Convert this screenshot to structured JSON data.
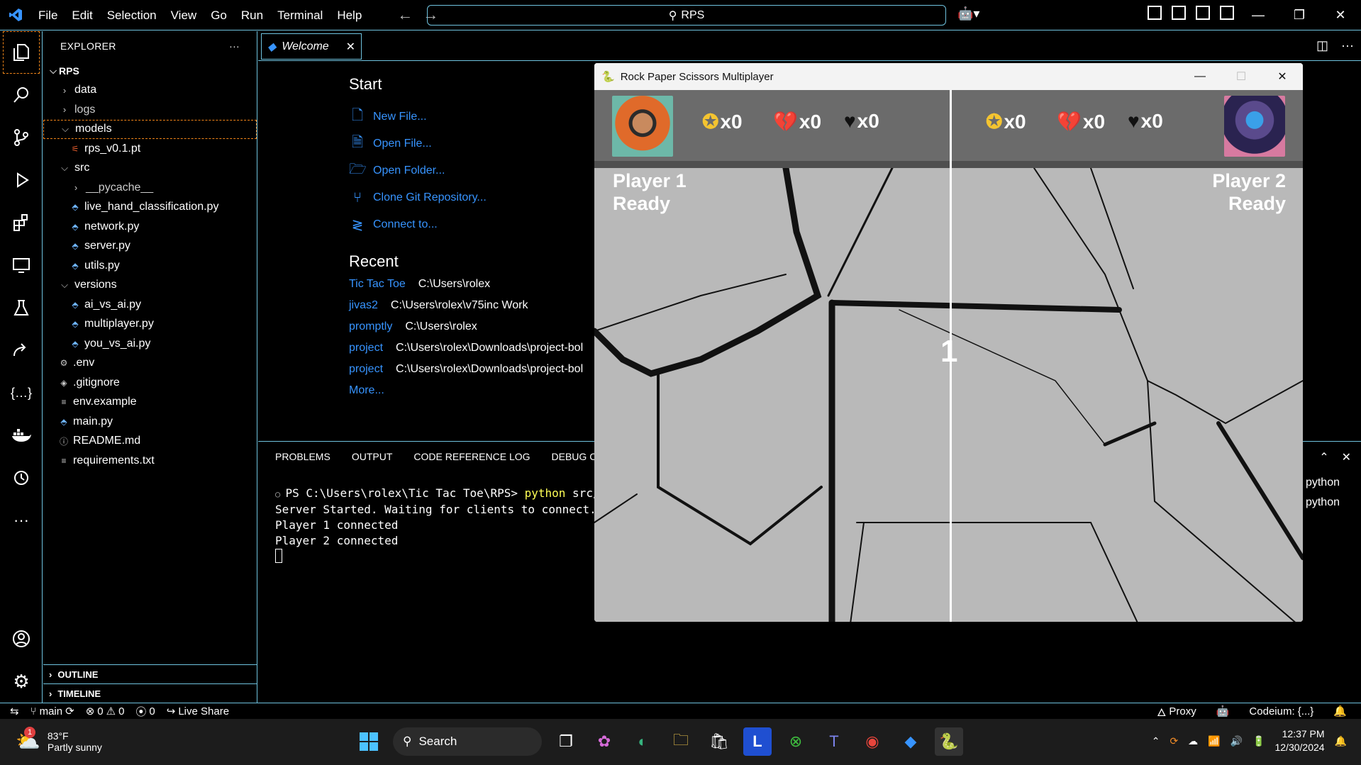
{
  "titlebar": {
    "menu": [
      "File",
      "Edit",
      "Selection",
      "View",
      "Go",
      "Run",
      "Terminal",
      "Help"
    ],
    "search": "RPS"
  },
  "explorer": {
    "title": "EXPLORER",
    "root": "RPS",
    "items": [
      {
        "label": "data",
        "indent": 1,
        "type": "folder-collapsed"
      },
      {
        "label": "logs",
        "indent": 1,
        "type": "folder-collapsed"
      },
      {
        "label": "models",
        "indent": 1,
        "type": "folder-open"
      },
      {
        "label": "rps_v0.1.pt",
        "indent": 2,
        "type": "pt"
      },
      {
        "label": "src",
        "indent": 1,
        "type": "folder-open"
      },
      {
        "label": "__pycache__",
        "indent": 2,
        "type": "folder-collapsed"
      },
      {
        "label": "live_hand_classification.py",
        "indent": 2,
        "type": "py"
      },
      {
        "label": "network.py",
        "indent": 2,
        "type": "py"
      },
      {
        "label": "server.py",
        "indent": 2,
        "type": "py"
      },
      {
        "label": "utils.py",
        "indent": 2,
        "type": "py"
      },
      {
        "label": "versions",
        "indent": 1,
        "type": "folder-open"
      },
      {
        "label": "ai_vs_ai.py",
        "indent": 2,
        "type": "py"
      },
      {
        "label": "multiplayer.py",
        "indent": 2,
        "type": "py"
      },
      {
        "label": "you_vs_ai.py",
        "indent": 2,
        "type": "py"
      },
      {
        "label": ".env",
        "indent": 1,
        "type": "gear"
      },
      {
        "label": ".gitignore",
        "indent": 1,
        "type": "diamond"
      },
      {
        "label": "env.example",
        "indent": 1,
        "type": "lines"
      },
      {
        "label": "main.py",
        "indent": 1,
        "type": "py"
      },
      {
        "label": "README.md",
        "indent": 1,
        "type": "info"
      },
      {
        "label": "requirements.txt",
        "indent": 1,
        "type": "lines"
      }
    ],
    "outline": "OUTLINE",
    "timeline": "TIMELINE"
  },
  "editor": {
    "tab": "Welcome",
    "start_title": "Start",
    "start_items": [
      {
        "label": "New File...",
        "icon": "new-file-icon"
      },
      {
        "label": "Open File...",
        "icon": "open-file-icon"
      },
      {
        "label": "Open Folder...",
        "icon": "open-folder-icon"
      },
      {
        "label": "Clone Git Repository...",
        "icon": "git-clone-icon"
      },
      {
        "label": "Connect to...",
        "icon": "remote-icon"
      }
    ],
    "recent_title": "Recent",
    "recent": [
      {
        "name": "Tic Tac Toe",
        "path": "C:\\Users\\rolex"
      },
      {
        "name": "jivas2",
        "path": "C:\\Users\\rolex\\v75inc Work"
      },
      {
        "name": "promptly",
        "path": "C:\\Users\\rolex"
      },
      {
        "name": "project",
        "path": "C:\\Users\\rolex\\Downloads\\project-bol"
      },
      {
        "name": "project",
        "path": "C:\\Users\\rolex\\Downloads\\project-bol"
      }
    ],
    "more": "More..."
  },
  "panel": {
    "tabs": [
      "PROBLEMS",
      "OUTPUT",
      "CODE REFERENCE LOG",
      "DEBUG CONSOLE"
    ],
    "prompt": "PS C:\\Users\\rolex\\Tic Tac Toe\\RPS>",
    "command": "python",
    "command_args": "src/serv",
    "lines": [
      "Server Started. Waiting for clients to connect...",
      "Player 1 connected",
      "Player 2 connected"
    ],
    "sessions": [
      "python",
      "python"
    ]
  },
  "game": {
    "title": "Rock Paper Scissors Multiplayer",
    "p1_stats": [
      "x0",
      "x0",
      "x0"
    ],
    "p2_stats": [
      "x0",
      "x0",
      "x0"
    ],
    "p1_name": "Player 1",
    "p1_status": "Ready",
    "p2_name": "Player 2",
    "p2_status": "Ready",
    "countdown": "1"
  },
  "statusbar": {
    "branch": "main",
    "errors": "0",
    "warnings": "0",
    "ports": "0",
    "liveshare": "Live Share",
    "proxy": "Proxy",
    "codeium": "Codeium: {...}"
  },
  "taskbar": {
    "temp": "83°F",
    "weather": "Partly sunny",
    "badge": "1",
    "search": "Search",
    "time": "12:37 PM",
    "date": "12/30/2024"
  }
}
